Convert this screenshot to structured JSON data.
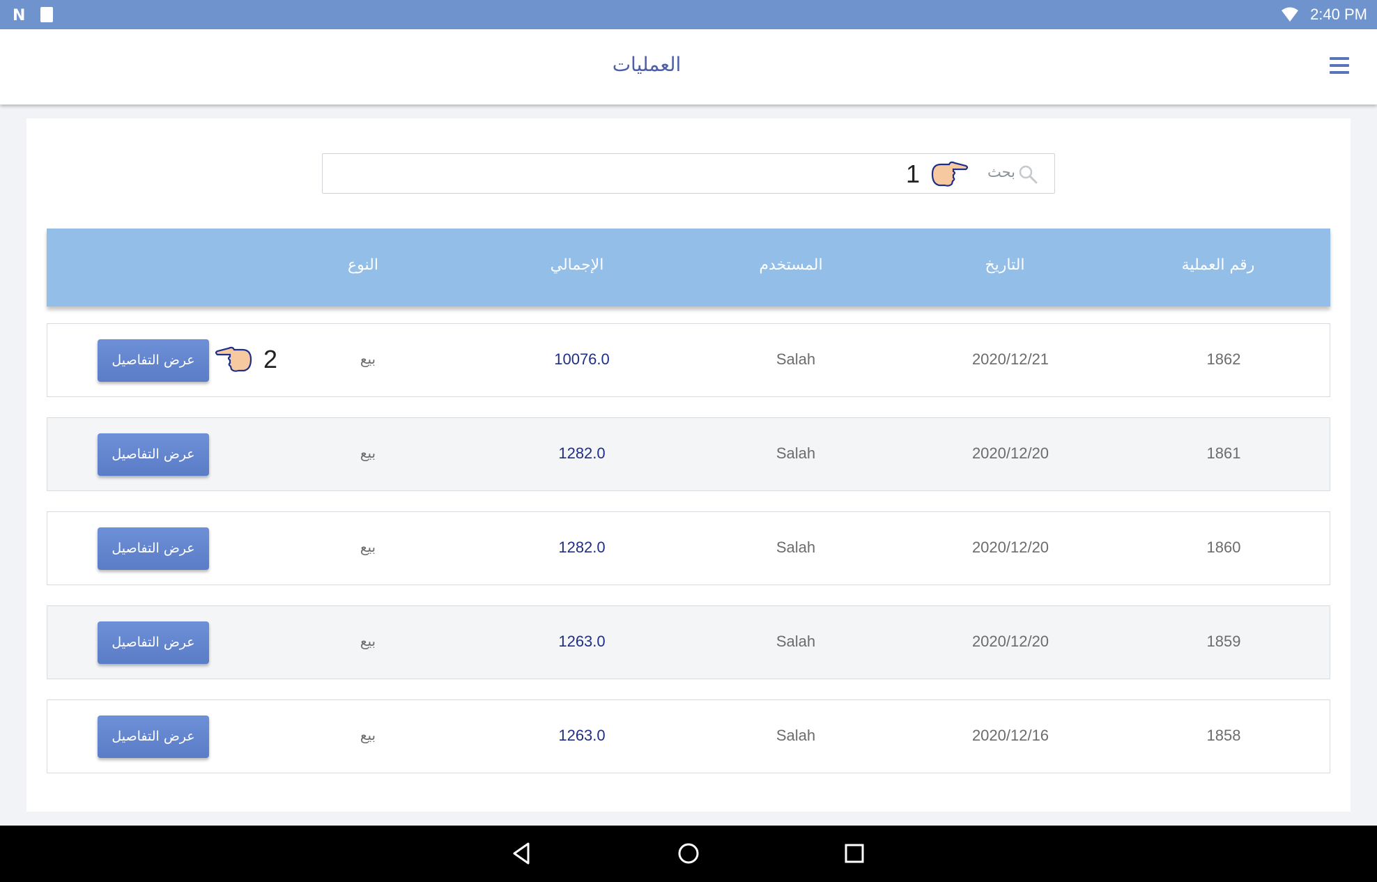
{
  "status_bar": {
    "time": "2:40 PM",
    "notification_icon": "n-logo-icon",
    "sd_icon": "sd-card-icon",
    "wifi_icon": "wifi-icon"
  },
  "app_bar": {
    "title": "العمليات",
    "menu_icon": "hamburger-menu-icon"
  },
  "search": {
    "placeholder": "بحث",
    "icon": "search-icon"
  },
  "hints": [
    {
      "number": "1",
      "icon": "pointing-hand-icon"
    },
    {
      "number": "2",
      "icon": "pointing-hand-icon"
    }
  ],
  "table": {
    "headers": {
      "id": "رقم العملية",
      "date": "التاريخ",
      "user": "المستخدم",
      "total": "الإجمالي",
      "type": "النوع"
    },
    "rows": [
      {
        "id": "1862",
        "date": "2020/12/21",
        "user": "Salah",
        "total": "10076.0",
        "type": "بيع",
        "action": "عرض التفاصيل"
      },
      {
        "id": "1861",
        "date": "2020/12/20",
        "user": "Salah",
        "total": "1282.0",
        "type": "بيع",
        "action": "عرض التفاصيل"
      },
      {
        "id": "1860",
        "date": "2020/12/20",
        "user": "Salah",
        "total": "1282.0",
        "type": "بيع",
        "action": "عرض التفاصيل"
      },
      {
        "id": "1859",
        "date": "2020/12/20",
        "user": "Salah",
        "total": "1263.0",
        "type": "بيع",
        "action": "عرض التفاصيل"
      },
      {
        "id": "1858",
        "date": "2020/12/16",
        "user": "Salah",
        "total": "1263.0",
        "type": "بيع",
        "action": "عرض التفاصيل"
      }
    ]
  },
  "nav_bar": {
    "back_icon": "back-triangle-icon",
    "home_icon": "home-circle-icon",
    "recents_icon": "recents-square-icon"
  },
  "colors": {
    "status_bar": "#6f93cc",
    "header": "#93bee7",
    "button": "#5b7cc6",
    "title": "#4d5fa6",
    "total_text": "#1f2e86"
  }
}
